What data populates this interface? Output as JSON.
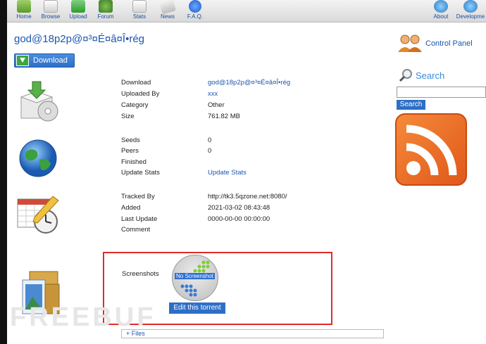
{
  "nav": {
    "items": [
      {
        "label": "Home",
        "icon": "home-icon"
      },
      {
        "label": "Browse",
        "icon": "browse-icon"
      },
      {
        "label": "Upload",
        "icon": "upload-icon"
      },
      {
        "label": "Forum",
        "icon": "forum-icon"
      },
      {
        "label": "Stats",
        "icon": "stats-icon"
      },
      {
        "label": "News",
        "icon": "news-icon"
      },
      {
        "label": "F.A.Q.",
        "icon": "faq-icon"
      }
    ],
    "right_items": [
      {
        "label": "About",
        "icon": "about-icon"
      },
      {
        "label": "Developme",
        "icon": "developer-icon"
      }
    ]
  },
  "torrent": {
    "title": "god@18p2p@¤³¤É¤â¤Î•rég",
    "download_button": "Download",
    "details": {
      "download_label": "Download",
      "download_value": "god@18p2p@¤³¤É¤â¤Î•rég",
      "uploaded_by_label": "Uploaded By",
      "uploaded_by_value": "xxx",
      "category_label": "Category",
      "category_value": "Other",
      "size_label": "Size",
      "size_value": "761.82 MB"
    },
    "stats": {
      "seeds_label": "Seeds",
      "seeds_value": "0",
      "peers_label": "Peers",
      "peers_value": "0",
      "finished_label": "Finished",
      "update_stats_label": "Update Stats",
      "update_stats_link": "Update Stats"
    },
    "tracking": {
      "tracked_by_label": "Tracked By",
      "tracked_by_value": "http://tk3.5qzone.net:8080/",
      "added_label": "Added",
      "added_value": "2021-03-02 08:43:48",
      "last_update_label": "Last Update",
      "last_update_value": "0000-00-00 00:00:00",
      "comment_label": "Comment"
    },
    "screenshots_label": "Screenshots",
    "no_screenshot_text": "No Screenshot",
    "edit_button": "Edit this torrent",
    "files_toggle": "+ Files"
  },
  "sidebar": {
    "control_panel": "Control Panel",
    "search_title": "Search",
    "search_value": "",
    "search_button": "Search"
  },
  "watermark": "FREEBUF",
  "colors": {
    "link": "#1a56b0",
    "button": "#2d6fc7",
    "highlight_border": "#e02a2a",
    "rss": "#f0742a"
  }
}
